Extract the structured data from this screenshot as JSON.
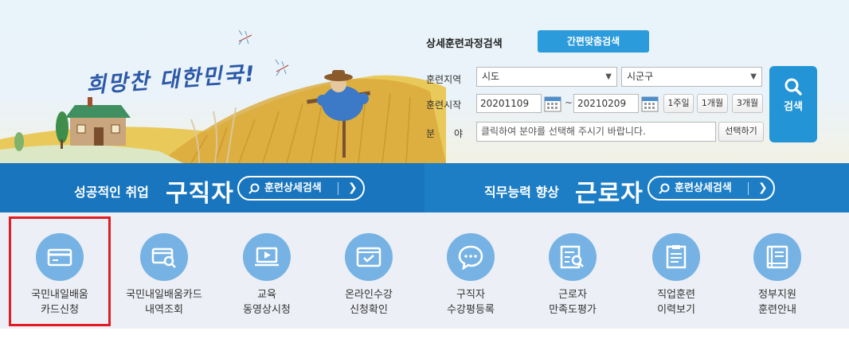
{
  "hero": {
    "slogan": "희망찬 대한민국",
    "slogan_bang": "!"
  },
  "search": {
    "title": "상세훈련과정검색",
    "quick_button": "간편맞춤검색",
    "region_label": "훈련지역",
    "region_select": "시도",
    "district_select": "시군구",
    "start_label": "훈련시작",
    "date_from": "20201109",
    "date_sep": "~",
    "date_to": "20210209",
    "period_buttons": [
      "1주일",
      "1개월",
      "3개월"
    ],
    "field_label": "분　　야",
    "field_placeholder": "클릭하여 분야를 선택해 주시기 바랍니다.",
    "select_button": "선택하기",
    "search_button": "검색"
  },
  "banner": {
    "left_sub": "성공적인 취업",
    "left_big": "구직자",
    "left_button": "훈련상세검색",
    "right_sub": "직무능력 향상",
    "right_big": "근로자",
    "right_button": "훈련상세검색"
  },
  "menu": [
    {
      "line1": "국민내일배움",
      "line2": "카드신청",
      "icon": "card-icon"
    },
    {
      "line1": "국민내일배움카드",
      "line2": "내역조회",
      "icon": "card-search-icon"
    },
    {
      "line1": "교육",
      "line2": "동영상시청",
      "icon": "video-icon"
    },
    {
      "line1": "온라인수강",
      "line2": "신청확인",
      "icon": "online-check-icon"
    },
    {
      "line1": "구직자",
      "line2": "수강평등록",
      "icon": "chat-icon"
    },
    {
      "line1": "근로자",
      "line2": "만족도평가",
      "icon": "survey-icon"
    },
    {
      "line1": "직업훈련",
      "line2": "이력보기",
      "icon": "history-icon"
    },
    {
      "line1": "정부지원",
      "line2": "훈련안내",
      "icon": "guide-book-icon"
    }
  ],
  "colors": {
    "accent": "#2394d5",
    "banner": "#1b78c2",
    "menu_circle": "#76b3e4",
    "highlight": "#e21c23"
  }
}
